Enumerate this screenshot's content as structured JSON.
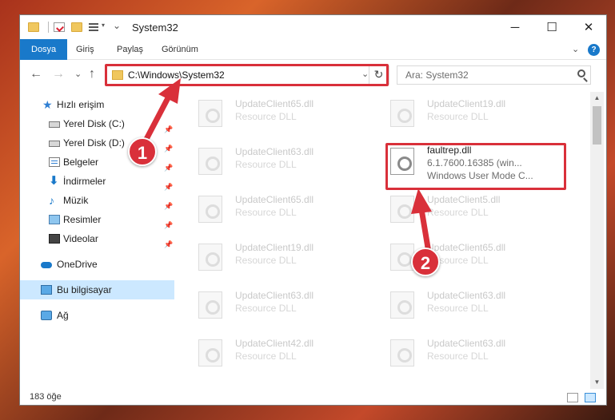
{
  "window": {
    "title": "System32",
    "controls": {
      "minimize": "─",
      "maximize": "☐",
      "close": "✕"
    }
  },
  "ribbon": {
    "tabs": [
      "Dosya",
      "Giriş",
      "Paylaş",
      "Görünüm"
    ],
    "active_color": "#1979ca"
  },
  "nav": {
    "back": "←",
    "forward": "→",
    "recent": "⌄",
    "up": "↑",
    "address": "C:\\Windows\\System32",
    "refresh": "↻",
    "search_placeholder": "Ara: System32"
  },
  "sidebar": {
    "items": [
      {
        "label": "Hızlı erişim",
        "icon": "star-icon"
      },
      {
        "label": "Yerel Disk (C:)",
        "icon": "drive-icon",
        "pinned": true
      },
      {
        "label": "Yerel Disk (D:)",
        "icon": "drive-icon",
        "pinned": true
      },
      {
        "label": "Belgeler",
        "icon": "documents-icon",
        "pinned": true
      },
      {
        "label": "İndirmeler",
        "icon": "download-icon",
        "pinned": true
      },
      {
        "label": "Müzik",
        "icon": "music-icon",
        "pinned": true
      },
      {
        "label": "Resimler",
        "icon": "pictures-icon",
        "pinned": true
      },
      {
        "label": "Videolar",
        "icon": "videos-icon",
        "pinned": true
      },
      {
        "label": "OneDrive",
        "icon": "cloud-icon"
      },
      {
        "label": "Bu bilgisayar",
        "icon": "computer-icon",
        "selected": true
      },
      {
        "label": "Ağ",
        "icon": "network-icon"
      }
    ]
  },
  "files": {
    "left": [
      {
        "name": "UpdateClient65.dll",
        "desc": "Resource DLL"
      },
      {
        "name": "UpdateClient63.dll",
        "desc": "Resource DLL"
      },
      {
        "name": "UpdateClient65.dll",
        "desc": "Resource DLL"
      },
      {
        "name": "UpdateClient19.dll",
        "desc": "Resource DLL"
      },
      {
        "name": "UpdateClient63.dll",
        "desc": "Resource DLL"
      },
      {
        "name": "UpdateClient42.dll",
        "desc": "Resource DLL"
      }
    ],
    "right": [
      {
        "name": "UpdateClient19.dll",
        "desc": "Resource DLL"
      },
      {
        "name": "faultrep.dll",
        "desc": "6.1.7600.16385 (win...",
        "desc2": "Windows User Mode C...",
        "highlight": true
      },
      {
        "name": "UpdateClient5.dll",
        "desc": "Resource DLL"
      },
      {
        "name": "UpdateClient65.dll",
        "desc": "Resource DLL"
      },
      {
        "name": "UpdateClient63.dll",
        "desc": "Resource DLL"
      },
      {
        "name": "UpdateClient63.dll",
        "desc": "Resource DLL"
      }
    ]
  },
  "status": {
    "count": "183 öğe"
  },
  "annotations": {
    "badge1": "1",
    "badge2": "2",
    "color": "#d9303a"
  }
}
